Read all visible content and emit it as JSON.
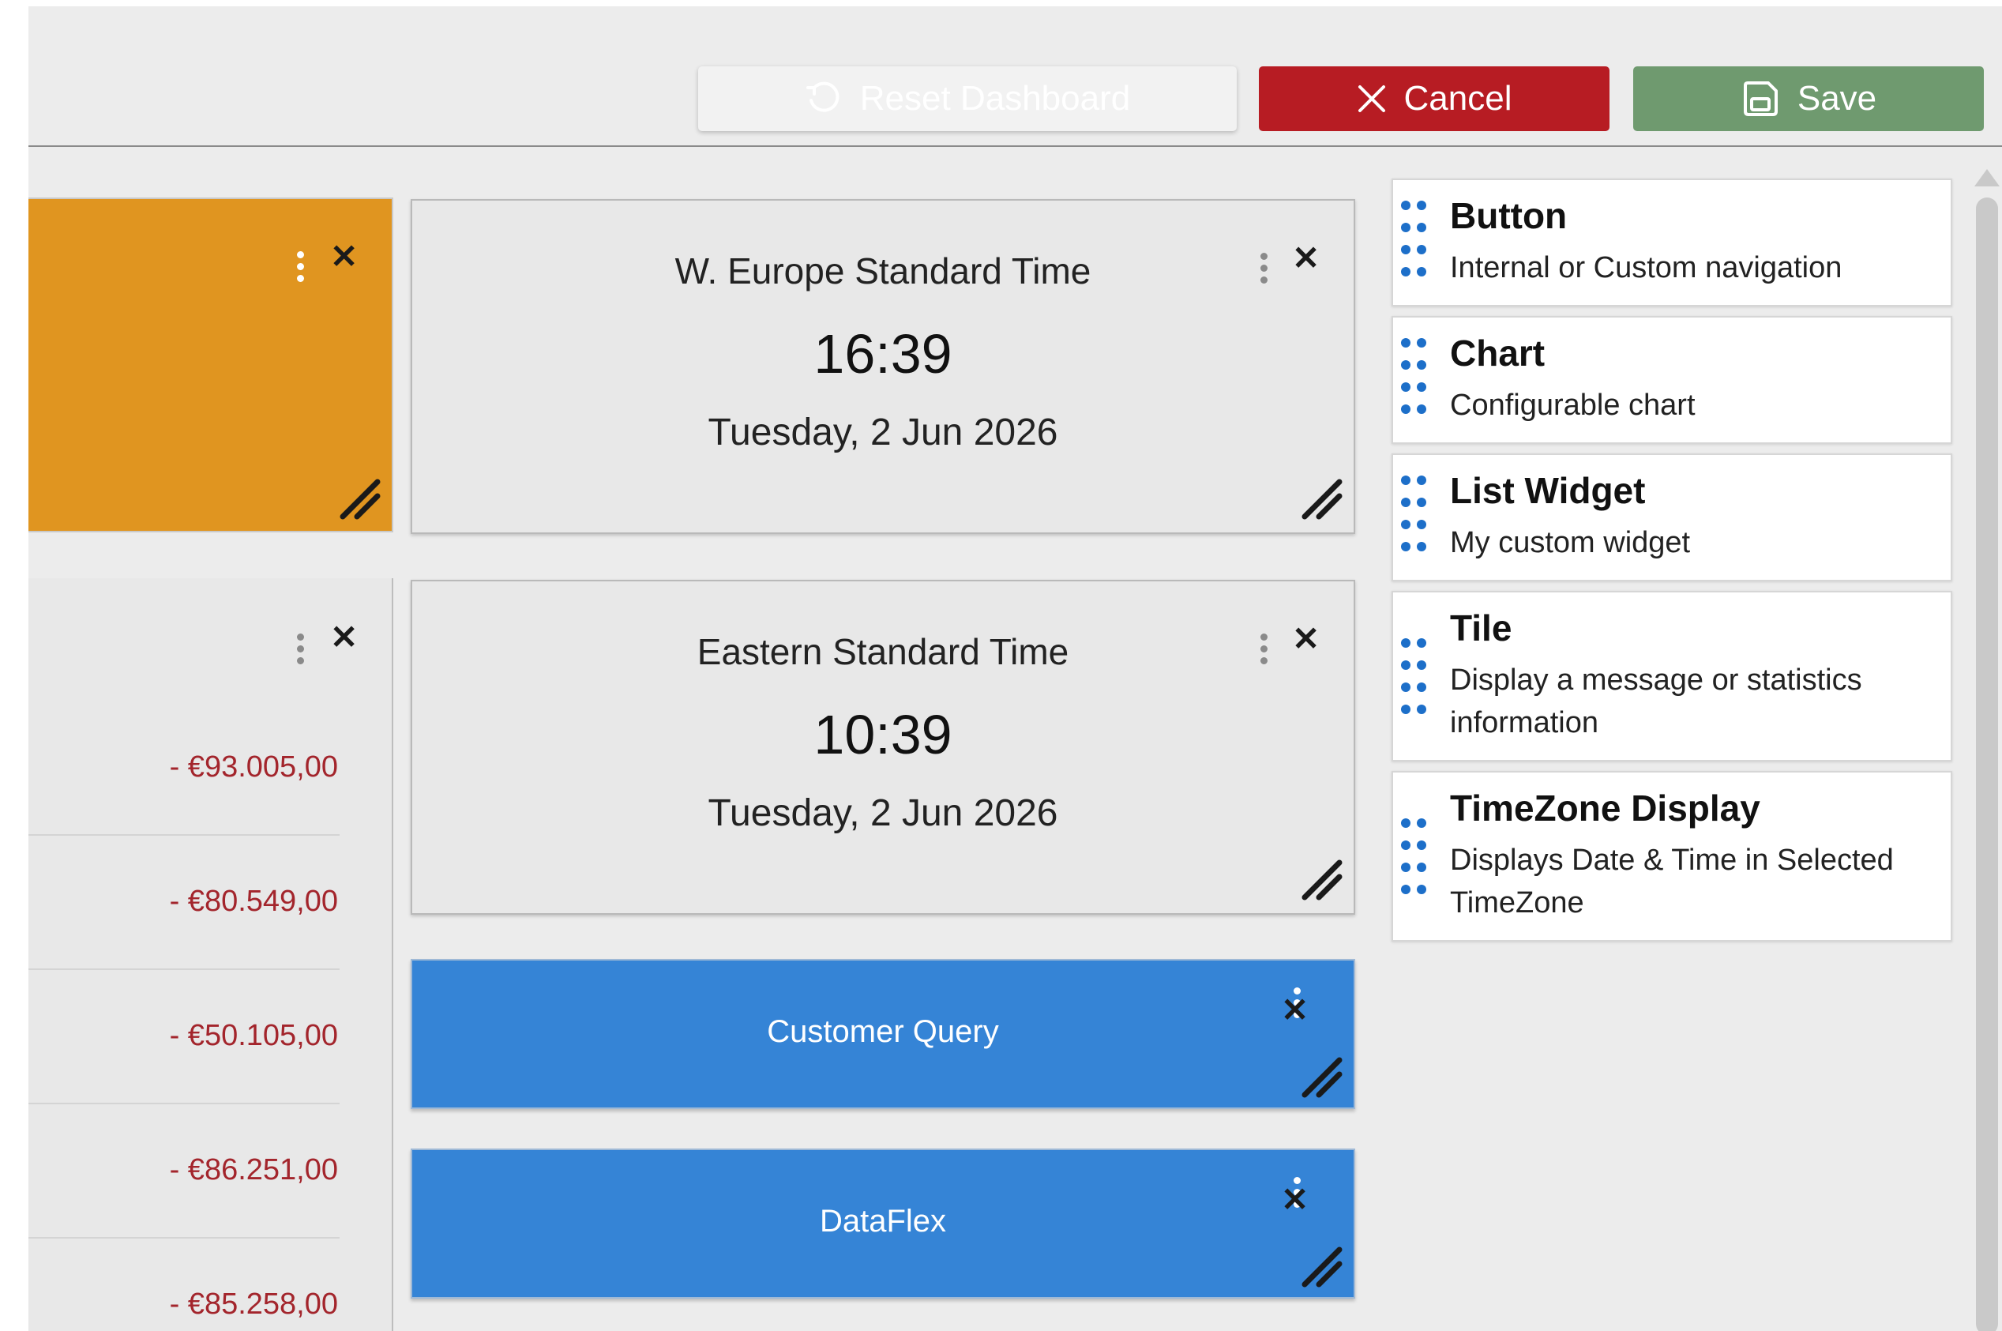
{
  "toolbar": {
    "reset_label": "Reset Dashboard",
    "cancel_label": "Cancel",
    "save_label": "Save"
  },
  "widgets": {
    "timezones": [
      {
        "name": "W. Europe Standard Time",
        "time": "16:39",
        "date": "Tuesday, 2 Jun 2026"
      },
      {
        "name": "Eastern Standard Time",
        "time": "10:39",
        "date": "Tuesday, 2 Jun 2026"
      }
    ],
    "tiles": [
      {
        "label": "Customer Query"
      },
      {
        "label": "DataFlex"
      }
    ],
    "list_values": [
      "- €93.005,00",
      "- €80.549,00",
      "- €50.105,00",
      "- €86.251,00",
      "- €85.258,00"
    ]
  },
  "palette": {
    "items": [
      {
        "title": "Button",
        "description": "Internal or Custom navigation"
      },
      {
        "title": "Chart",
        "description": "Configurable chart"
      },
      {
        "title": "List Widget",
        "description": "My custom widget"
      },
      {
        "title": "Tile",
        "description": "Display a message or statistics information"
      },
      {
        "title": "TimeZone Display",
        "description": "Displays Date & Time in Selected TimeZone"
      }
    ]
  },
  "colors": {
    "cancel": "#b71c23",
    "save": "#6f9a6f",
    "tile_blue": "#3584d6",
    "orange_widget": "#e09520",
    "negative_amount": "#a3252c",
    "drag_handle": "#1d6fc9"
  },
  "icons": {
    "reset": "reset-icon",
    "cancel": "close-icon",
    "save": "save-icon",
    "widget_menu": "kebab-menu-icon",
    "widget_close": "close-icon",
    "widget_resize": "resize-handle-icon",
    "palette_drag": "drag-handle-icon"
  }
}
